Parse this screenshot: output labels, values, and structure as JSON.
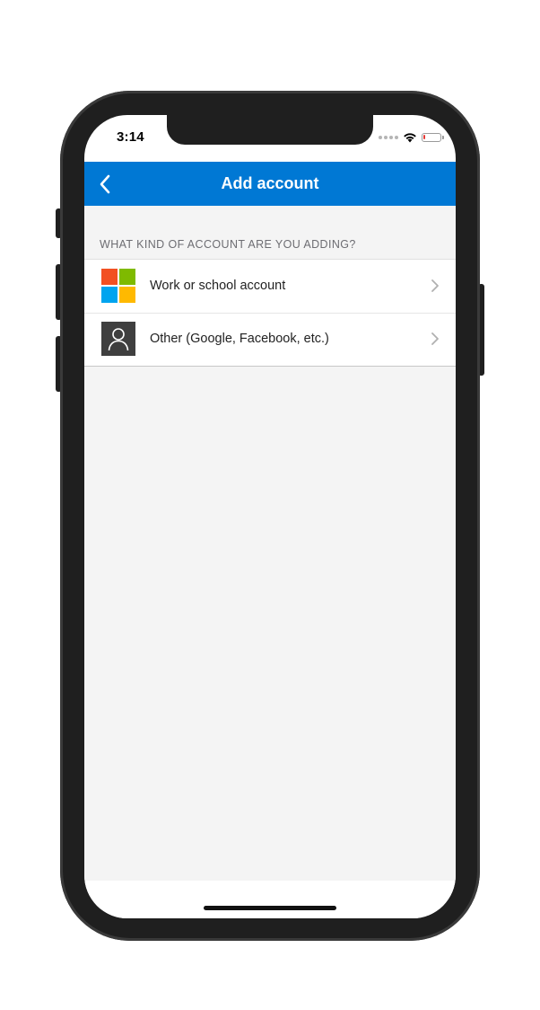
{
  "status_bar": {
    "time": "3:14",
    "icons": [
      "signal-dots-icon",
      "wifi-icon",
      "battery-icon"
    ],
    "battery_level_percent": 10,
    "battery_color": "#e53935"
  },
  "nav": {
    "title": "Add account",
    "back_icon": "chevron-left-icon",
    "background_color": "#0078d4"
  },
  "section": {
    "header": "WHAT KIND OF ACCOUNT ARE YOU ADDING?"
  },
  "accounts": [
    {
      "label": "Work or school account",
      "icon": "microsoft-logo-icon",
      "logo_colors": [
        "#f25022",
        "#7fba00",
        "#00a4ef",
        "#ffb900"
      ]
    },
    {
      "label": "Other (Google, Facebook, etc.)",
      "icon": "person-icon"
    }
  ]
}
